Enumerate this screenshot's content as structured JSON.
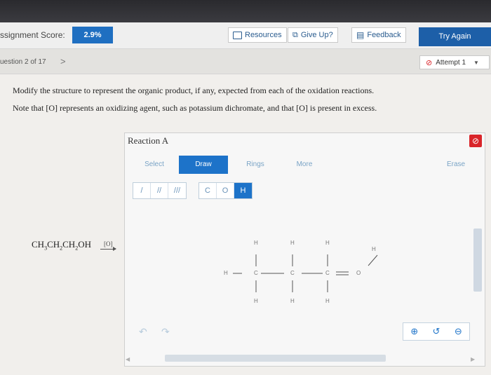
{
  "top_bar": {
    "score_label": "ssignment Score:",
    "score_value": "2.9%",
    "resources_label": "Resources",
    "giveup_label": "Give Up?",
    "feedback_label": "Feedback",
    "try_again_label": "Try Again"
  },
  "question_bar": {
    "question_label": "uestion 2 of 17",
    "next_label": ">",
    "attempt_label": "Attempt 1"
  },
  "instructions": {
    "line1": "Modify the structure to represent the organic product, if any, expected from each of the oxidation reactions.",
    "line2": "Note that [O] represents an oxidizing agent, such as potassium dichromate, and that [O] is present in excess."
  },
  "reaction": {
    "reactant_html": "CH3CH2CH2OH",
    "reagent": "[O]"
  },
  "panel": {
    "title": "Reaction A",
    "tabs": {
      "select": "Select",
      "draw": "Draw",
      "rings": "Rings",
      "more": "More",
      "erase": "Erase"
    },
    "bond_tools": [
      "/",
      "//",
      "///"
    ],
    "atom_tools": [
      "C",
      "O",
      "H"
    ]
  },
  "molecule": {
    "atoms": [
      "H",
      "C",
      "C",
      "C",
      "O",
      "H",
      "H",
      "H",
      "H",
      "H",
      "H",
      "H"
    ]
  },
  "colors": {
    "accent": "#1d73c9",
    "danger": "#d9252a"
  }
}
